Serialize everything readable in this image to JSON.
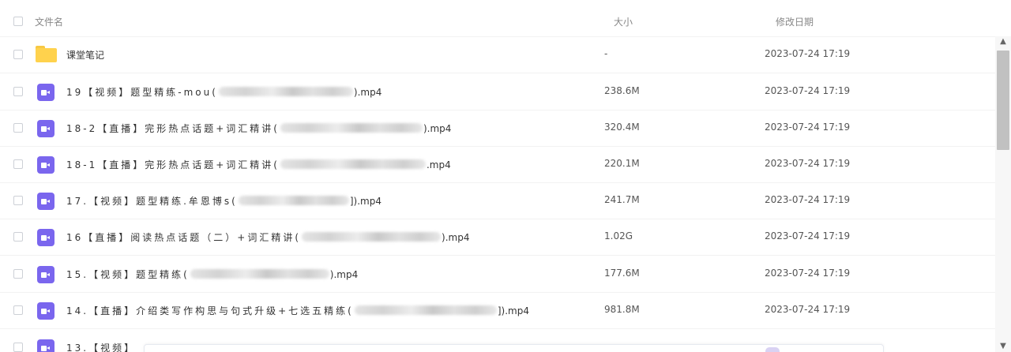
{
  "header": {
    "name_label": "文件名",
    "size_label": "大小",
    "date_label": "修改日期"
  },
  "rows": [
    {
      "type": "folder",
      "name_before": "课堂笔记",
      "name_after": "",
      "size": "-",
      "date": "2023-07-24 17:19"
    },
    {
      "type": "video",
      "name_before": "19【视频】题型精练-mou(",
      "name_after": ").mp4",
      "size": "238.6M",
      "date": "2023-07-24 17:19"
    },
    {
      "type": "video",
      "name_before": "18-2【直播】完形热点话题+词汇精讲(",
      "name_after": ").mp4",
      "size": "320.4M",
      "date": "2023-07-24 17:19"
    },
    {
      "type": "video",
      "name_before": "18-1【直播】完形热点话题+词汇精讲(",
      "name_after": ".mp4",
      "size": "220.1M",
      "date": "2023-07-24 17:19"
    },
    {
      "type": "video",
      "name_before": "17.【视频】题型精练.牟恩博s(",
      "name_after": "]).mp4",
      "size": "241.7M",
      "date": "2023-07-24 17:19"
    },
    {
      "type": "video",
      "name_before": "16【直播】阅读热点话题（二）+词汇精讲(",
      "name_after": ").mp4",
      "size": "1.02G",
      "date": "2023-07-24 17:19"
    },
    {
      "type": "video",
      "name_before": "15.【视频】题型精练(",
      "name_after": ").mp4",
      "size": "177.6M",
      "date": "2023-07-24 17:19"
    },
    {
      "type": "video",
      "name_before": "14.【直播】介绍类写作构思与句式升级+七选五精练(",
      "name_after": "]).mp4",
      "size": "981.8M",
      "date": "2023-07-24 17:19"
    },
    {
      "type": "video",
      "name_before": "13.【视频】",
      "name_after": "",
      "size": "",
      "date": ""
    }
  ],
  "scrollbar": {
    "up_glyph": "▲",
    "down_glyph": "▼"
  },
  "icons": {
    "folder": "folder-icon",
    "video": "video-file-icon",
    "checkbox": "checkbox"
  },
  "colors": {
    "video_icon": "#7a66ee",
    "folder_icon": "#ffd24d",
    "header_text": "#888888",
    "row_text": "#333333"
  }
}
